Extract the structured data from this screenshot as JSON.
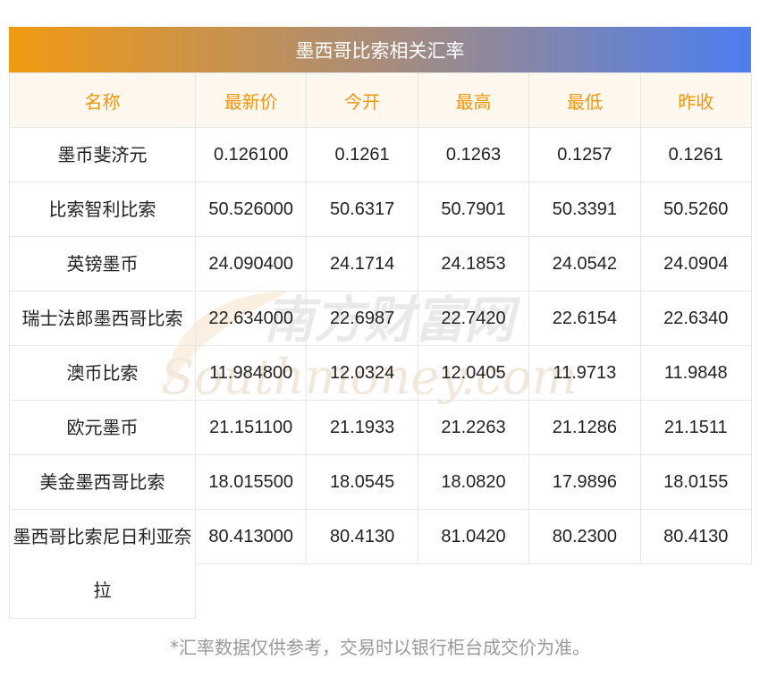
{
  "title": "墨西哥比索相关汇率",
  "columns": [
    "名称",
    "最新价",
    "今开",
    "最高",
    "最低",
    "昨收"
  ],
  "rows": [
    {
      "name": "墨币斐济元",
      "values": [
        "0.126100",
        "0.1261",
        "0.1263",
        "0.1257",
        "0.1261"
      ]
    },
    {
      "name": "比索智利比索",
      "values": [
        "50.526000",
        "50.6317",
        "50.7901",
        "50.3391",
        "50.5260"
      ]
    },
    {
      "name": "英镑墨币",
      "values": [
        "24.090400",
        "24.1714",
        "24.1853",
        "24.0542",
        "24.0904"
      ]
    },
    {
      "name": "瑞士法郎墨西哥比索",
      "values": [
        "22.634000",
        "22.6987",
        "22.7420",
        "22.6154",
        "22.6340"
      ]
    },
    {
      "name": "澳币比索",
      "values": [
        "11.984800",
        "12.0324",
        "12.0405",
        "11.9713",
        "11.9848"
      ]
    },
    {
      "name": "欧元墨币",
      "values": [
        "21.151100",
        "21.1933",
        "21.2263",
        "21.1286",
        "21.1511"
      ]
    },
    {
      "name": "美金墨西哥比索",
      "values": [
        "18.015500",
        "18.0545",
        "18.0820",
        "17.9896",
        "18.0155"
      ]
    },
    {
      "name": "墨西哥比索尼日利亚奈拉",
      "values": [
        "80.413000",
        "80.4130",
        "81.0420",
        "80.2300",
        "80.4130"
      ]
    }
  ],
  "watermark": {
    "cn": "南方财富网",
    "en": "Southmoney.com"
  },
  "footnote": "*汇率数据仅供参考，交易时以银行柜台成交价为准。"
}
